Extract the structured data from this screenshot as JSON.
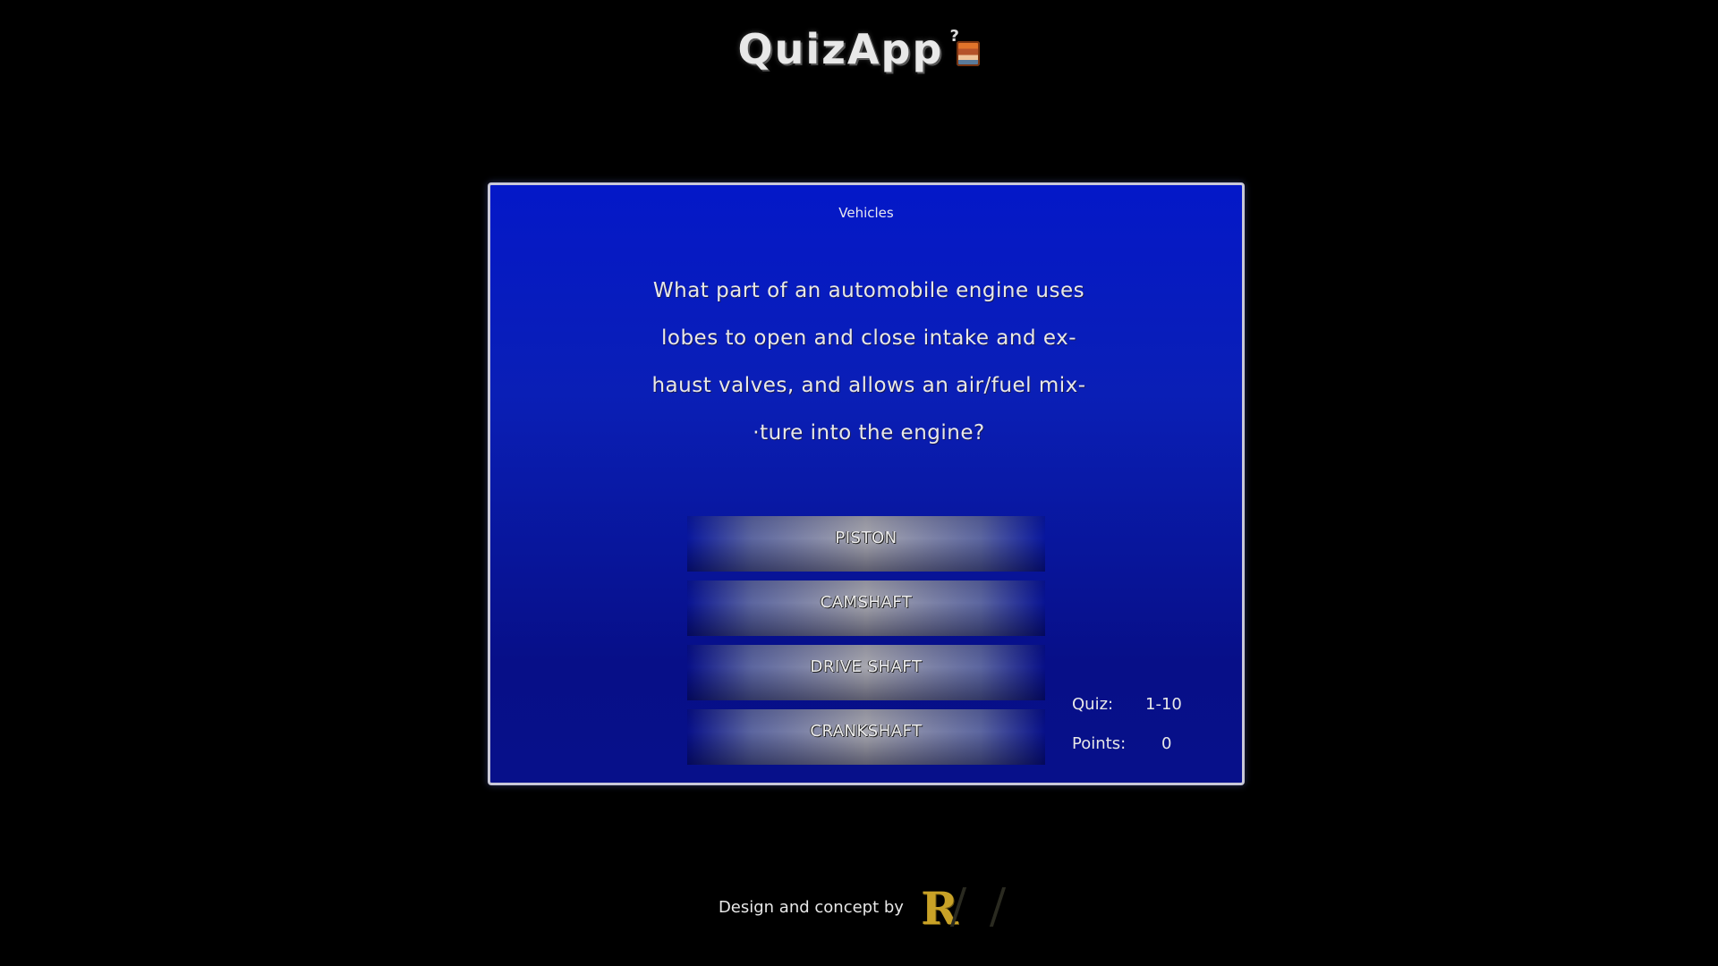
{
  "app": {
    "title": "QuizApp",
    "icon_mark": "?",
    "icon": "pixel-character-icon"
  },
  "quiz": {
    "category": "Vehicles",
    "question_lines": [
      "What part of an automobile engine uses",
      "lobes to open and close intake and ex-",
      "haust valves, and allows an air/fuel mix-",
      "·ture into the engine?"
    ],
    "answers": [
      {
        "label": "PISTON"
      },
      {
        "label": "CAMSHAFT"
      },
      {
        "label": "DRIVE SHAFT"
      },
      {
        "label": "CRANKSHAFT"
      }
    ]
  },
  "stats": {
    "quiz_label": "Quiz:",
    "quiz_value": "1-10",
    "points_label": "Points:",
    "points_value": "0"
  },
  "footer": {
    "text": "Design and concept by",
    "logo": "author-logo-icon"
  },
  "colors": {
    "background": "#000000",
    "panel_top": "#0418c8",
    "panel_bottom": "#07108a",
    "panel_border": "#c8c8d8",
    "text": "#e8e8e8",
    "logo_gold": "#c9a227"
  }
}
